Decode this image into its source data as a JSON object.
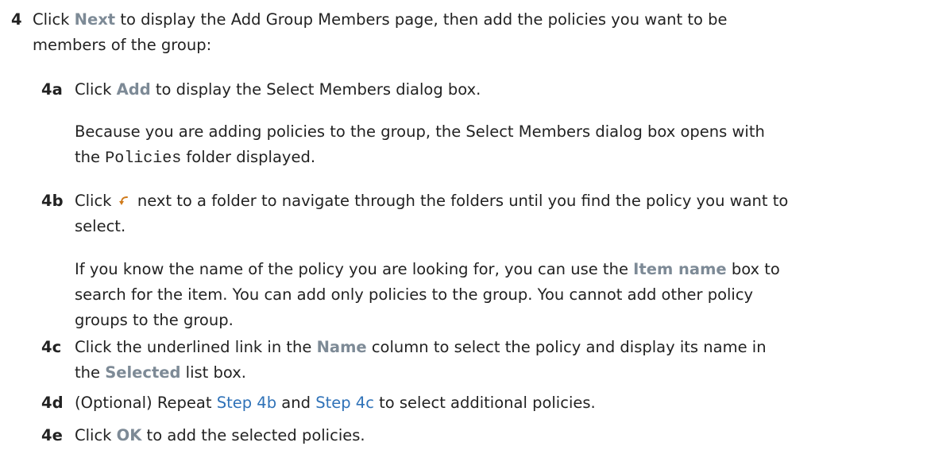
{
  "step4": {
    "number": "4",
    "pre": "Click ",
    "next_ui": "Next",
    "line1_rest": " to display the Add Group Members page, then add the policies you want to be",
    "line2": "members of the group:"
  },
  "step4a": {
    "number": "4a",
    "pre": "Click ",
    "ui": "Add",
    "post": " to display the Select Members dialog box.",
    "note_line1": "Because you are adding policies to the group, the Select Members dialog box opens with",
    "note_line2_pre": "the ",
    "note_line2_code": "Policies",
    "note_line2_post": " folder displayed."
  },
  "step4b": {
    "number": "4b",
    "pre": "Click",
    "icon": "navigate-arrow-icon",
    "line1_post": "next to a folder to navigate through the folders until you find the policy you want to",
    "line2": "select.",
    "note_line1_pre": "If you know the name of the policy you are looking for, you can use the ",
    "note_line1_ui": "Item name",
    "note_line1_post": " box to",
    "note_line2": "search for the item. You can add only policies to the group. You cannot add other policy",
    "note_line3": "groups to the group."
  },
  "step4c": {
    "number": "4c",
    "pre": "Click the underlined link in the ",
    "ui_name": "Name",
    "line1_post": " column to select the policy and display its name in",
    "line2_pre": "the ",
    "ui_selected": "Selected",
    "line2_post": " list box."
  },
  "step4d": {
    "number": "4d",
    "pre": "(Optional) Repeat ",
    "link1": "Step 4b",
    "mid": " and ",
    "link2": "Step 4c",
    "post": " to select additional policies."
  },
  "step4e": {
    "number": "4e",
    "pre": "Click ",
    "ui": "OK",
    "post": " to add the selected policies."
  },
  "colors": {
    "ui_label": "#7d8a96",
    "link": "#2f72b8",
    "text": "#222222",
    "icon": "#d07a1a"
  }
}
